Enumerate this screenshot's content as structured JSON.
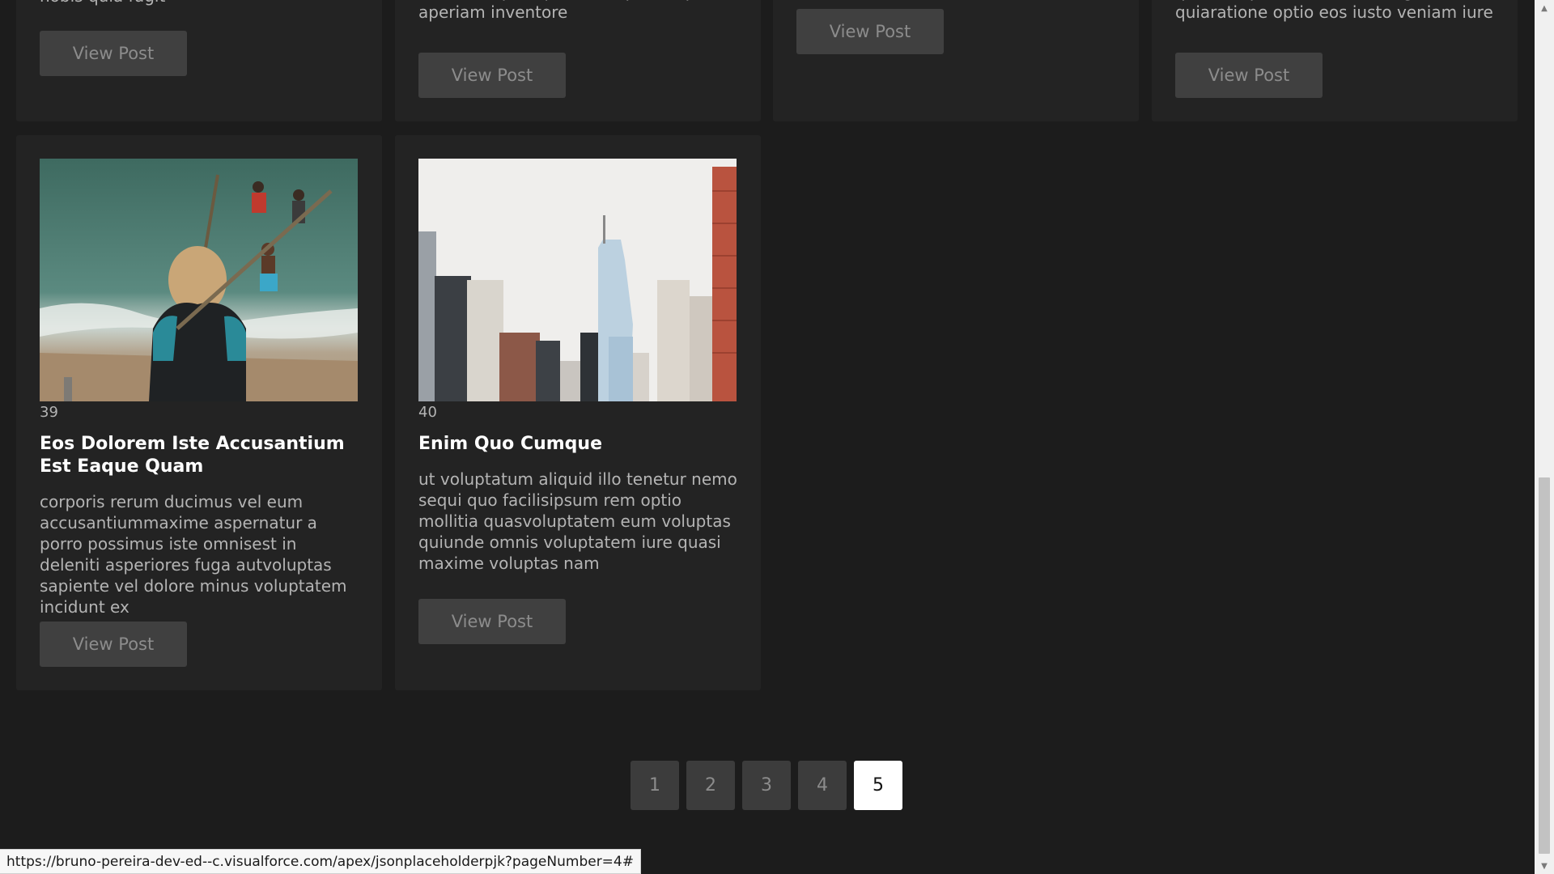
{
  "posts_partial_top": [
    {
      "excerpt_tail": "nobis quia fugit",
      "button_label": "View Post"
    },
    {
      "excerpt_tail": "occaecatiqui aspernatur quia eaque ut\naperiam inventore",
      "button_label": "View Post"
    },
    {
      "excerpt_tail": "",
      "button_label": "View Post"
    },
    {
      "excerpt_tail": "quia voluptatem delectus fugit aut id\nquiaratione optio eos iusto veniam iure",
      "button_label": "View Post"
    }
  ],
  "posts": [
    {
      "number": "39",
      "title": "Eos Dolorem Iste Accusantium Est Eaque Quam",
      "excerpt": "corporis rerum ducimus vel eum accusantiummaxime aspernatur a porro possimus iste omnisest in deleniti asperiores fuga autvoluptas sapiente vel dolore minus voluptatem incidunt ex",
      "button_label": "View Post",
      "image": "beach-surfers-photo"
    },
    {
      "number": "40",
      "title": "Enim Quo Cumque",
      "excerpt": "ut voluptatum aliquid illo tenetur nemo sequi quo facilisipsum rem optio mollitia quasvoluptatem eum voluptas quiunde omnis voluptatem iure quasi maxime voluptas nam",
      "button_label": "View Post",
      "image": "city-skyline-photo"
    }
  ],
  "pagination": {
    "pages": [
      "1",
      "2",
      "3",
      "4",
      "5"
    ],
    "active": "5"
  },
  "status_url": "https://bruno-pereira-dev-ed--c.visualforce.com/apex/jsonplaceholderpjk?pageNumber=4#",
  "colors": {
    "background": "#1c1c1c",
    "card": "#232323",
    "button": "#404040",
    "active_page": "#ffffff"
  }
}
